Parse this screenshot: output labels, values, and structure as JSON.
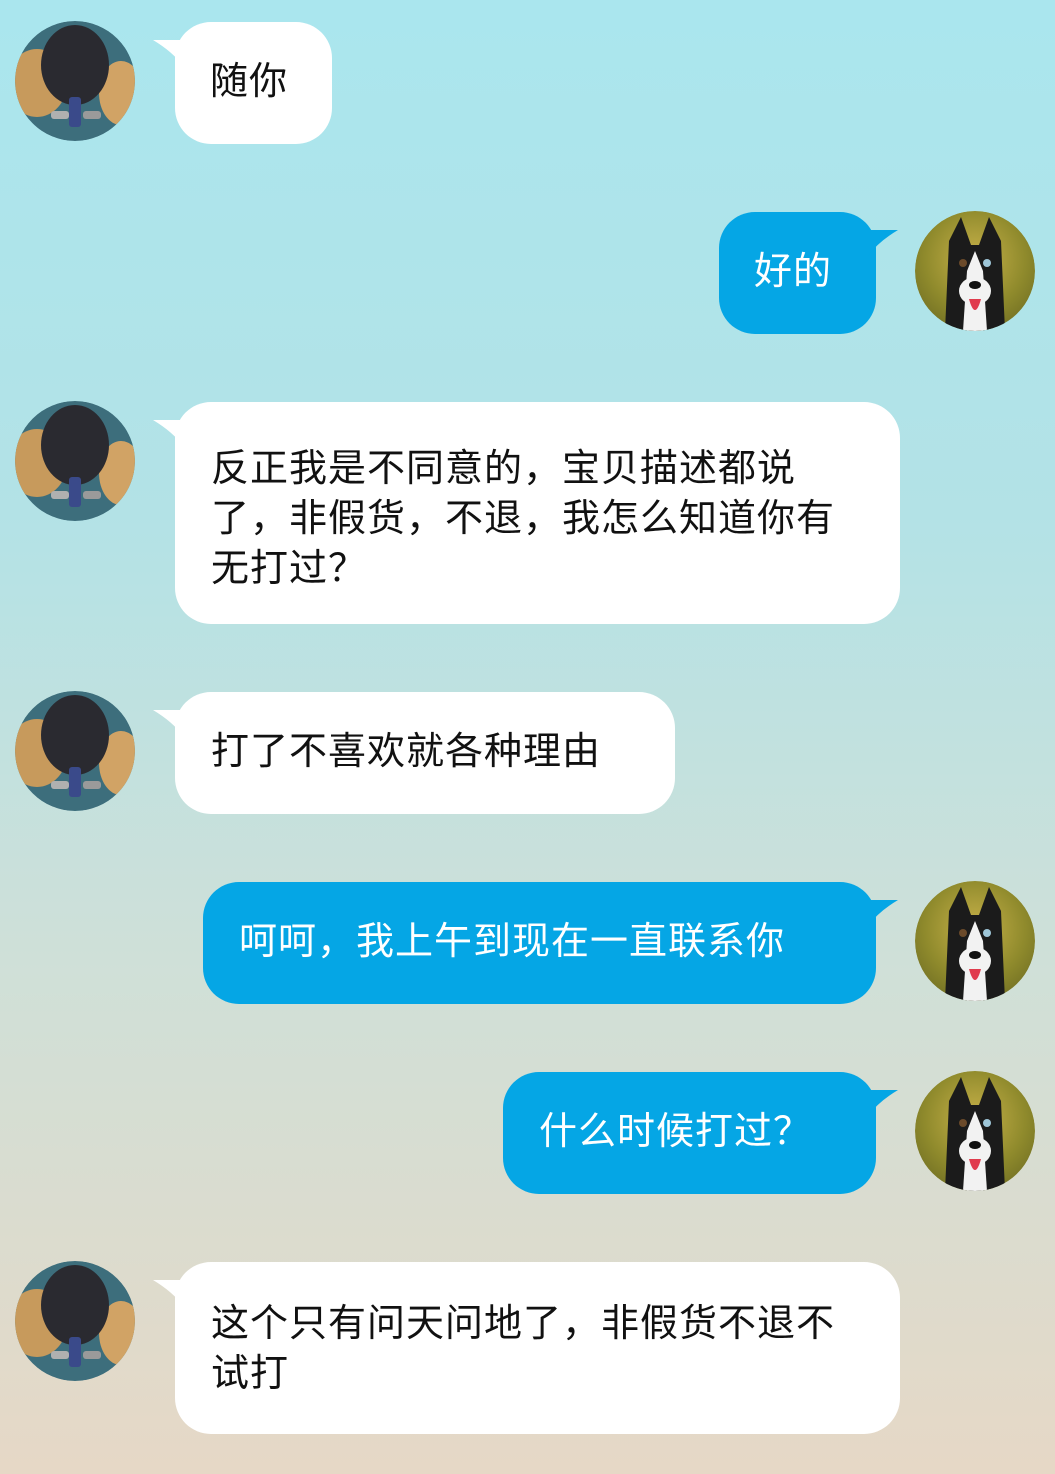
{
  "colors": {
    "incoming_bubble": "#ffffff",
    "outgoing_bubble": "#05a6e5",
    "incoming_text": "#111111",
    "outgoing_text": "#ffffff"
  },
  "avatars": {
    "other": "ping-pong-paddles-avatar",
    "me": "husky-dog-avatar"
  },
  "messages": [
    {
      "sender": "other",
      "text": "随你"
    },
    {
      "sender": "me",
      "text": "好的"
    },
    {
      "sender": "other",
      "text": "反正我是不同意的，宝贝描述都说了，非假货，不退，我怎么知道你有无打过？"
    },
    {
      "sender": "other",
      "text": "打了不喜欢就各种理由"
    },
    {
      "sender": "me",
      "text": "呵呵，我上午到现在一直联系你"
    },
    {
      "sender": "me",
      "text": "什么时候打过？"
    },
    {
      "sender": "other",
      "text": "这个只有问天问地了，非假货不退不试打"
    }
  ]
}
